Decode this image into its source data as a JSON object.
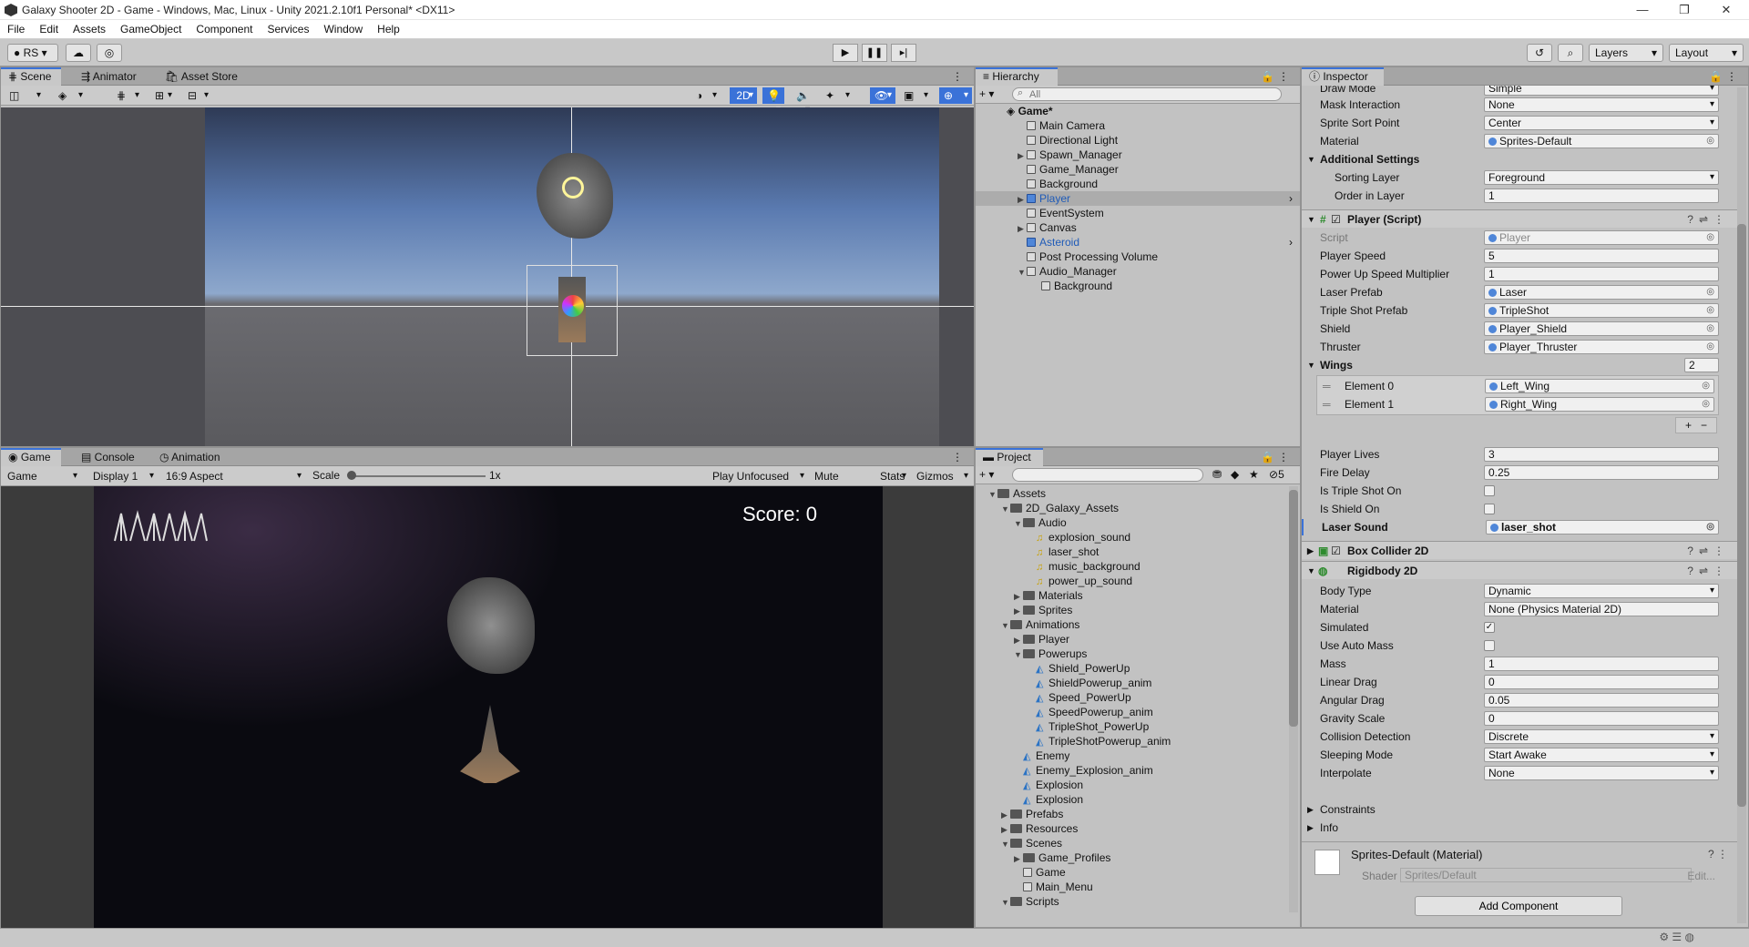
{
  "window": {
    "title": "Galaxy Shooter 2D - Game - Windows, Mac, Linux - Unity 2021.2.10f1 Personal* <DX11>"
  },
  "menu": [
    "File",
    "Edit",
    "Assets",
    "GameObject",
    "Component",
    "Services",
    "Window",
    "Help"
  ],
  "toolbar": {
    "account": "RS",
    "layers": "Layers",
    "layout": "Layout"
  },
  "scene_panel": {
    "tabs": [
      "Scene",
      "Animator",
      "Asset Store"
    ],
    "mode_2d": "2D"
  },
  "game_panel": {
    "tabs": [
      "Game",
      "Console",
      "Animation"
    ],
    "view": "Game",
    "display": "Display 1",
    "aspect": "16:9 Aspect",
    "scale_label": "Scale",
    "scale_value": "1x",
    "play_mode": "Play Unfocused",
    "mute": "Mute Audio",
    "stats": "Stats",
    "gizmos": "Gizmos",
    "score": "Score: 0"
  },
  "hierarchy": {
    "title": "Hierarchy",
    "search_placeholder": "All",
    "scene": "Game*",
    "items": [
      {
        "label": "Main Camera",
        "depth": 1,
        "expander": "",
        "selected": false,
        "prefab": false
      },
      {
        "label": "Directional Light",
        "depth": 1,
        "expander": "",
        "selected": false,
        "prefab": false
      },
      {
        "label": "Spawn_Manager",
        "depth": 1,
        "expander": "▶",
        "selected": false,
        "prefab": false
      },
      {
        "label": "Game_Manager",
        "depth": 1,
        "expander": "",
        "selected": false,
        "prefab": false
      },
      {
        "label": "Background",
        "depth": 1,
        "expander": "",
        "selected": false,
        "prefab": false
      },
      {
        "label": "Player",
        "depth": 1,
        "expander": "▶",
        "selected": true,
        "prefab": true
      },
      {
        "label": "EventSystem",
        "depth": 1,
        "expander": "",
        "selected": false,
        "prefab": false
      },
      {
        "label": "Canvas",
        "depth": 1,
        "expander": "▶",
        "selected": false,
        "prefab": false
      },
      {
        "label": "Asteroid",
        "depth": 1,
        "expander": "",
        "selected": false,
        "prefab": true
      },
      {
        "label": "Post Processing Volume",
        "depth": 1,
        "expander": "",
        "selected": false,
        "prefab": false
      },
      {
        "label": "Audio_Manager",
        "depth": 1,
        "expander": "▼",
        "selected": false,
        "prefab": false
      },
      {
        "label": "Background",
        "depth": 2,
        "expander": "",
        "selected": false,
        "prefab": false
      }
    ]
  },
  "project": {
    "title": "Project",
    "hidden_count": "5",
    "items": [
      {
        "label": "Assets",
        "depth": 0,
        "expander": "▼",
        "kind": "folder"
      },
      {
        "label": "2D_Galaxy_Assets",
        "depth": 1,
        "expander": "▼",
        "kind": "folder"
      },
      {
        "label": "Audio",
        "depth": 2,
        "expander": "▼",
        "kind": "folder"
      },
      {
        "label": "explosion_sound",
        "depth": 3,
        "expander": "",
        "kind": "audio"
      },
      {
        "label": "laser_shot",
        "depth": 3,
        "expander": "",
        "kind": "audio"
      },
      {
        "label": "music_background",
        "depth": 3,
        "expander": "",
        "kind": "audio"
      },
      {
        "label": "power_up_sound",
        "depth": 3,
        "expander": "",
        "kind": "audio"
      },
      {
        "label": "Materials",
        "depth": 2,
        "expander": "▶",
        "kind": "folder"
      },
      {
        "label": "Sprites",
        "depth": 2,
        "expander": "▶",
        "kind": "folder"
      },
      {
        "label": "Animations",
        "depth": 1,
        "expander": "▼",
        "kind": "folder"
      },
      {
        "label": "Player",
        "depth": 2,
        "expander": "▶",
        "kind": "folder"
      },
      {
        "label": "Powerups",
        "depth": 2,
        "expander": "▼",
        "kind": "folder"
      },
      {
        "label": "Shield_PowerUp",
        "depth": 3,
        "expander": "",
        "kind": "anim"
      },
      {
        "label": "ShieldPowerup_anim",
        "depth": 3,
        "expander": "",
        "kind": "anim"
      },
      {
        "label": "Speed_PowerUp",
        "depth": 3,
        "expander": "",
        "kind": "anim"
      },
      {
        "label": "SpeedPowerup_anim",
        "depth": 3,
        "expander": "",
        "kind": "anim"
      },
      {
        "label": "TripleShot_PowerUp",
        "depth": 3,
        "expander": "",
        "kind": "anim"
      },
      {
        "label": "TripleShotPowerup_anim",
        "depth": 3,
        "expander": "",
        "kind": "anim"
      },
      {
        "label": "Enemy",
        "depth": 2,
        "expander": "",
        "kind": "anim"
      },
      {
        "label": "Enemy_Explosion_anim",
        "depth": 2,
        "expander": "",
        "kind": "anim"
      },
      {
        "label": "Explosion",
        "depth": 2,
        "expander": "",
        "kind": "anim"
      },
      {
        "label": "Explosion",
        "depth": 2,
        "expander": "",
        "kind": "anim"
      },
      {
        "label": "Prefabs",
        "depth": 1,
        "expander": "▶",
        "kind": "folder"
      },
      {
        "label": "Resources",
        "depth": 1,
        "expander": "▶",
        "kind": "folder"
      },
      {
        "label": "Scenes",
        "depth": 1,
        "expander": "▼",
        "kind": "folder"
      },
      {
        "label": "Game_Profiles",
        "depth": 2,
        "expander": "▶",
        "kind": "folder"
      },
      {
        "label": "Game",
        "depth": 2,
        "expander": "",
        "kind": "scene"
      },
      {
        "label": "Main_Menu",
        "depth": 2,
        "expander": "",
        "kind": "scene"
      },
      {
        "label": "Scripts",
        "depth": 1,
        "expander": "▼",
        "kind": "folder"
      }
    ]
  },
  "inspector": {
    "title": "Inspector",
    "sprite_renderer": [
      {
        "label": "Draw Mode",
        "value": "Simple",
        "type": "dropdown"
      },
      {
        "label": "Mask Interaction",
        "value": "None",
        "type": "dropdown"
      },
      {
        "label": "Sprite Sort Point",
        "value": "Center",
        "type": "dropdown"
      },
      {
        "label": "Material",
        "value": "Sprites-Default",
        "type": "object"
      }
    ],
    "additional_settings": "Additional Settings",
    "additional": [
      {
        "label": "Sorting Layer",
        "value": "Foreground",
        "type": "dropdown"
      },
      {
        "label": "Order in Layer",
        "value": "1",
        "type": "field"
      }
    ],
    "player_script": {
      "title": "Player (Script)",
      "script_label": "Script",
      "script_value": "Player",
      "fields": [
        {
          "label": "Player Speed",
          "value": "5",
          "type": "field"
        },
        {
          "label": "Power Up Speed Multiplier",
          "value": "1",
          "type": "field"
        },
        {
          "label": "Laser Prefab",
          "value": "Laser",
          "type": "object"
        },
        {
          "label": "Triple Shot Prefab",
          "value": "TripleShot",
          "type": "object"
        },
        {
          "label": "Shield",
          "value": "Player_Shield",
          "type": "object"
        },
        {
          "label": "Thruster",
          "value": "Player_Thruster",
          "type": "object"
        }
      ],
      "wings_label": "Wings",
      "wings_count": "2",
      "wings": [
        {
          "label": "Element 0",
          "value": "Left_Wing"
        },
        {
          "label": "Element 1",
          "value": "Right_Wing"
        }
      ],
      "fields2": [
        {
          "label": "Player Lives",
          "value": "3",
          "type": "field"
        },
        {
          "label": "Fire Delay",
          "value": "0.25",
          "type": "field"
        }
      ],
      "is_triple_shot_on": "Is Triple Shot On",
      "is_shield_on": "Is Shield On",
      "laser_sound_label": "Laser Sound",
      "laser_sound_value": "laser_shot"
    },
    "box_collider": "Box Collider 2D",
    "rigidbody": {
      "title": "Rigidbody 2D",
      "body_type": "Dynamic",
      "material": "None (Physics Material 2D)",
      "simulated": "Simulated",
      "use_auto_mass": "Use Auto Mass",
      "fields": [
        {
          "label": "Mass",
          "value": "1"
        },
        {
          "label": "Linear Drag",
          "value": "0"
        },
        {
          "label": "Angular Drag",
          "value": "0.05"
        },
        {
          "label": "Gravity Scale",
          "value": "0"
        }
      ],
      "dropdowns": [
        {
          "label": "Collision Detection",
          "value": "Discrete"
        },
        {
          "label": "Sleeping Mode",
          "value": "Start Awake"
        },
        {
          "label": "Interpolate",
          "value": "None"
        }
      ],
      "constraints": "Constraints",
      "info": "Info"
    },
    "material_asset": {
      "title": "Sprites-Default (Material)",
      "shader_label": "Shader",
      "shader_value": "Sprites/Default",
      "edit": "Edit..."
    },
    "add_component": "Add Component"
  },
  "colors": {
    "accent": "#3a72d8",
    "selected_row": "#acacac",
    "prefab_blue": "#1f5bb8"
  }
}
